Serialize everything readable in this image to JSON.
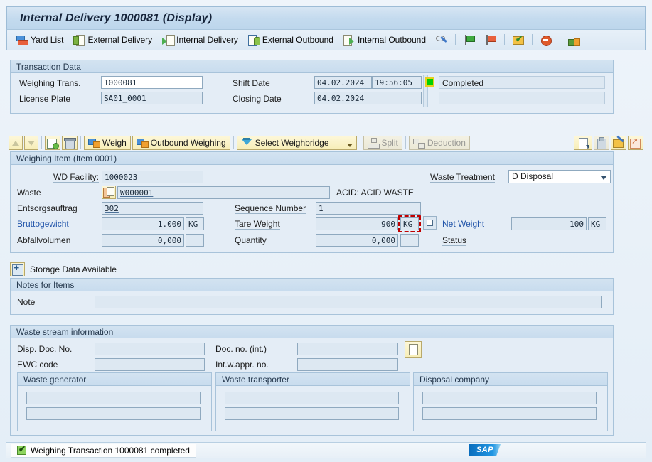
{
  "window": {
    "title": "Internal Delivery 1000081 (Display)"
  },
  "toolbar": {
    "items": [
      {
        "label": "Yard List",
        "icon": "yard-truck-icon"
      },
      {
        "label": "External Delivery",
        "icon": "external-delivery-icon"
      },
      {
        "label": "Internal Delivery",
        "icon": "internal-delivery-icon"
      },
      {
        "label": "External Outbound",
        "icon": "external-outbound-icon"
      },
      {
        "label": "Internal Outbound",
        "icon": "internal-outbound-icon"
      }
    ],
    "icon_buttons": [
      {
        "name": "display-change-icon"
      },
      {
        "name": "green-flag-icon"
      },
      {
        "name": "red-flag-icon"
      },
      {
        "name": "check-document-icon"
      },
      {
        "name": "stop-icon"
      },
      {
        "name": "unlock-icon"
      }
    ]
  },
  "transaction_data": {
    "header": "Transaction Data",
    "weighing_trans_label": "Weighing Trans.",
    "weighing_trans_value": "1000081",
    "license_plate_label": "License Plate",
    "license_plate_value": "SA01_0001",
    "shift_date_label": "Shift Date",
    "shift_date_value": "04.02.2024",
    "shift_time_value": "19:56:05",
    "closing_date_label": "Closing Date",
    "closing_date_value": "04.02.2024",
    "status_text": "Completed",
    "status_color": "#00d000"
  },
  "item_actions": {
    "move_up": "",
    "move_down": "",
    "create": "",
    "delete": "",
    "weigh": "Weigh",
    "outbound_weighing": "Outbound Weighing",
    "select_weighbridge": "Select Weighbridge",
    "split": "Split",
    "deduction": "Deduction"
  },
  "item_right_icons": [
    {
      "name": "new-document-icon"
    },
    {
      "name": "clipboard-icon"
    },
    {
      "name": "edit-note-icon"
    },
    {
      "name": "expand-icon"
    }
  ],
  "weighing_item": {
    "header": "Weighing Item (Item 0001)",
    "wd_facility_label": "WD Facility:",
    "wd_facility_value": "1000023",
    "waste_label": "Waste",
    "waste_value": "W000001",
    "waste_desc": "ACID: ACID WASTE",
    "entsorgsauftrag_label": "Entsorgsauftrag",
    "entsorgsauftrag_value": "302",
    "sequence_number_label": "Sequence Number",
    "sequence_number_value": "1",
    "waste_treatment_label": "Waste Treatment",
    "waste_treatment_value": "D Disposal",
    "waste_treatment_options": [
      "D Disposal"
    ],
    "bruttogewicht_label": "Bruttogewicht",
    "bruttogewicht_value": "1.000",
    "bruttogewicht_unit": "KG",
    "abfallvolumen_label": "Abfallvolumen",
    "abfallvolumen_value": "0,000",
    "abfallvolumen_unit": "",
    "tare_weight_label": "Tare Weight",
    "tare_weight_value": "900",
    "tare_weight_unit": "KG",
    "quantity_label": "Quantity",
    "quantity_value": "0,000",
    "quantity_unit": "",
    "net_weight_label": "Net Weight",
    "net_weight_value": "100",
    "net_weight_unit": "KG",
    "status_label": "Status",
    "status_value": ""
  },
  "storage": {
    "label": "Storage Data Available"
  },
  "notes": {
    "header": "Notes for Items",
    "note_label": "Note",
    "note_value": ""
  },
  "waste_stream": {
    "header": "Waste stream information",
    "disp_doc_no_label": "Disp. Doc. No.",
    "disp_doc_no_value": "",
    "ewc_code_label": "EWC code",
    "ewc_code_value": "",
    "doc_no_int_label": "Doc. no. (int.)",
    "doc_no_int_value": "",
    "int_w_appr_no_label": "Int.w.appr. no.",
    "int_w_appr_no_value": "",
    "boxes": [
      {
        "title": "Waste generator",
        "line1": "",
        "line2": ""
      },
      {
        "title": "Waste transporter",
        "line1": "",
        "line2": ""
      },
      {
        "title": "Disposal company",
        "line1": "",
        "line2": ""
      }
    ]
  },
  "statusbar": {
    "message": "Weighing Transaction 1000081 completed",
    "logo": "SAP"
  }
}
